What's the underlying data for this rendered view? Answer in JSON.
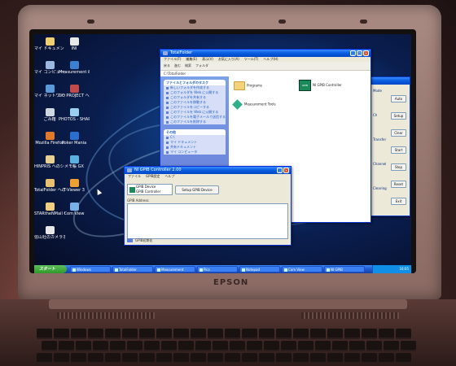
{
  "device": {
    "brand": "EPSON"
  },
  "desktop": {
    "icons": [
      {
        "label": "マイ ドキュメント",
        "color": "#f0d070",
        "icon": "folder-icon"
      },
      {
        "label": "INI",
        "color": "#e8e8e8",
        "icon": "file-icon"
      },
      {
        "label": "マイ コンピュータ",
        "color": "#9ab8e0",
        "icon": "computer-icon"
      },
      {
        "label": "Measurement & Automation",
        "color": "#3a7fd0",
        "icon": "app-icon"
      },
      {
        "label": "マイ ネットワーク",
        "color": "#5a9ad8",
        "icon": "network-icon"
      },
      {
        "label": "GO PROJECT ヘのショートカット",
        "color": "#c24a4a",
        "icon": "shortcut-icon"
      },
      {
        "label": "ごみ箱",
        "color": "#cfd8e0",
        "icon": "recycle-bin-icon"
      },
      {
        "label": "PHOTOS - SHARTS",
        "color": "#9ad0f0",
        "icon": "photos-icon"
      },
      {
        "label": "Mozilla Firefox",
        "color": "#e07a2a",
        "icon": "firefox-icon"
      },
      {
        "label": "Poker Mania",
        "color": "#2a6fd0",
        "icon": "app-icon"
      },
      {
        "label": "HINPRIS ヘのショートカット",
        "color": "#e8d090",
        "icon": "folder-icon"
      },
      {
        "label": "メモ帳 GX",
        "color": "#5ab0e0",
        "icon": "notepad-icon"
      },
      {
        "label": "TotalFolder ヘのショートカット",
        "color": "#e8c070",
        "icon": "folder-icon"
      },
      {
        "label": "T-Viewer 3",
        "color": "#f0a030",
        "icon": "viewer-icon"
      },
      {
        "label": "STARtheNMail ヘのショートカット",
        "color": "#f0d080",
        "icon": "folder-icon"
      },
      {
        "label": "Com View",
        "color": "#7ab0e8",
        "icon": "app-icon"
      },
      {
        "label": "信山社のカメラホルダ",
        "color": "#e8e8e8",
        "icon": "file-icon"
      }
    ]
  },
  "explorer": {
    "title": "TotalFolder",
    "menu": [
      "ファイル(F)",
      "編集(E)",
      "表示(V)",
      "お気に入り(A)",
      "ツール(T)",
      "ヘルプ(H)"
    ],
    "toolbar": [
      "戻る",
      "進む",
      "検索",
      "フォルダ"
    ],
    "address": "C:\\TotalFolder",
    "task_panel_title": "ファイルとフォルダのタスク",
    "task_links": [
      "新しいフォルダを作成する",
      "このフォルダを Web に公開する",
      "このフォルダを共有する",
      "このファイルを移動する",
      "このファイルをコピーする",
      "このファイルを Web に公開する",
      "このファイルを電子メールで送信する",
      "このファイルを削除する"
    ],
    "other_panel_title": "その他",
    "other_links": [
      "C:\\",
      "マイ ドキュメント",
      "共有ドキュメント",
      "マイ コンピュータ"
    ],
    "items": [
      {
        "name": "Programs"
      },
      {
        "name": "NI GPIB Controller",
        "detail": "GPIB"
      },
      {
        "name": "Measurement Tools"
      }
    ]
  },
  "side_window": {
    "title": "",
    "labels": [
      "Mode",
      "Ch",
      "Transfer",
      "Channel",
      "Clearing"
    ],
    "buttons": [
      "Auto",
      "Setup",
      "Clear",
      "Start",
      "Stop",
      "Reset",
      "Exit"
    ]
  },
  "gpib": {
    "title": "NI GPIB Controller 2.00",
    "menu": [
      "ファイル",
      "GPIB設定",
      "ヘルプ"
    ],
    "device_box": "GPIB Device",
    "device_sub": "GPIB Controller",
    "setup_button": "Setup GPIB Device",
    "field_label": "GPIB Address",
    "status": "GPIB初期化"
  },
  "taskbar": {
    "start_label": "スタート",
    "items": [
      "Windows",
      "TotalFolder",
      "Measurement",
      "Pics",
      "Notepad",
      "Com View",
      "NI GPIB"
    ],
    "clock": "16:05"
  }
}
